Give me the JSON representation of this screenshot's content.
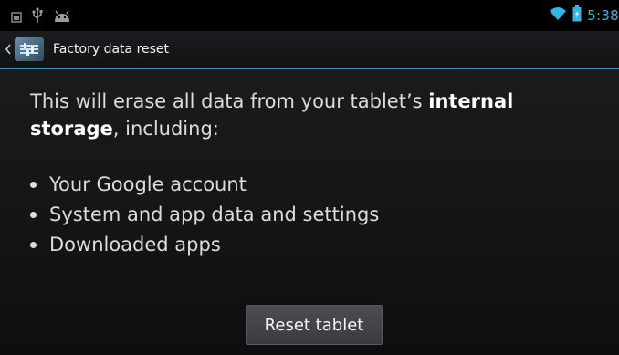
{
  "status_bar": {
    "time": "5:38",
    "icons": [
      "gallery-notification-icon",
      "usb-icon",
      "android-debug-icon",
      "wifi-icon",
      "battery-icon"
    ]
  },
  "action_bar": {
    "title": "Factory data reset",
    "up_icon": "chevron-left-icon",
    "app_icon": "settings-app-icon"
  },
  "content": {
    "description_part1": "This will erase all data from your tablet’s ",
    "description_bold1": "internal storage",
    "description_part2": ", including:",
    "items": [
      {
        "label": "Your Google account"
      },
      {
        "label": "System and app data and settings"
      },
      {
        "label": "Downloaded apps"
      }
    ],
    "reset_button_label": "Reset tablet"
  },
  "colors": {
    "accent": "#33b5e5",
    "divider": "#3a8fb7",
    "background": "#131416"
  }
}
